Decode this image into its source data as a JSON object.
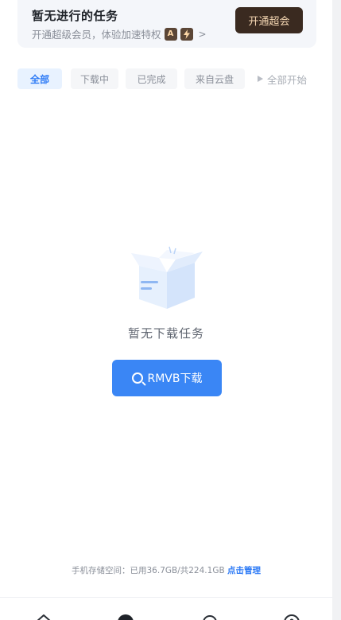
{
  "vip_banner": {
    "title": "暂无进行的任务",
    "subtitle": "开通超级会员，体验加速特权",
    "chevron": ">",
    "button_label": "开通超会",
    "perk_icons": [
      "vip-badge-icon",
      "speed-boost-icon"
    ],
    "perk_badge_glyph": "A",
    "button_color": "#3a2a20"
  },
  "tabs": [
    {
      "label": "全部",
      "active": true
    },
    {
      "label": "下载中",
      "active": false
    },
    {
      "label": "已完成",
      "active": false
    },
    {
      "label": "来自云盘",
      "active": false
    }
  ],
  "start_all": {
    "label": "全部开始",
    "icon": "play-icon"
  },
  "empty_state": {
    "text": "暂无下载任务",
    "illustration": "empty-box-icon",
    "search_button_label": "RMVB下载",
    "search_icon": "search-icon"
  },
  "storage": {
    "text": "手机存储空间：已用36.7GB/共224.1GB",
    "manage_label": "点击管理"
  },
  "bottom_nav": {
    "icons": [
      "home-icon",
      "download-icon",
      "discover-icon",
      "profile-icon"
    ]
  },
  "colors": {
    "accent": "#2e7bf6",
    "vip_button": "#3a2a20",
    "vip_text": "#f5d7b3"
  }
}
